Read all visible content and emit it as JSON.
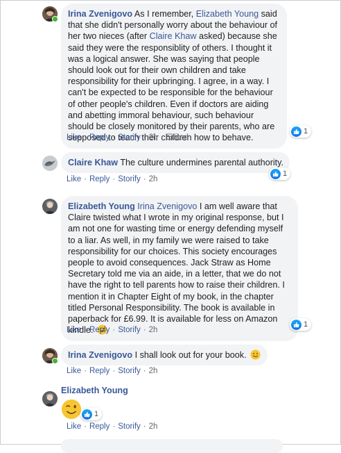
{
  "comments": [
    {
      "author": "Irina Zvenigovo",
      "text_before": " As I remember, ",
      "mention1": "Elizabeth Young",
      "text_mid": " said that she didn't personally worry about the behaviour of her two nieces (after ",
      "mention2": "Claire Khaw",
      "text_after": " asked) because she said they were the responsiblity of others. I thought it was a logical answer. She was saying that people should look out for their own children and take responsibility for their upbringing. I agree, in a way. I can't be expected to be responsible for the behaviour of other people's children. Even if doctors are aiding and abetting immoral behaviour, such behaviour should be closely monitored by their parents, who are supposed to teach their children how to behave.",
      "actions": {
        "like": "Like",
        "reply": "Reply",
        "storify": "Storify",
        "time": "2h",
        "edited": "Edited"
      },
      "reaction_count": "1"
    },
    {
      "author": "Claire Khaw",
      "text": " The culture undermines parental authority.",
      "actions": {
        "like": "Like",
        "reply": "Reply",
        "storify": "Storify",
        "time": "2h"
      },
      "reaction_count": "1"
    },
    {
      "author": "Elizabeth Young",
      "mention": " Irina Zvenigovo",
      "text": " I am well aware that Claire twisted what I wrote in my original response, but I am not one for wasting time or energy defending myself to a liar. As well, in my family we were raised to take responsibility for our choices. This society encourages people to avoid consequences. Jack Straw as Home Secretary told me via an aide, in a letter, that we do not have the right to tell parents how to raise their children. I mention it in Chapter Eight of my book, in the chapter titled Personal Responsibility. The book is available in paperback for £6.99. It is available for less on Amazon kindle.",
      "emoji": "smile-emoji",
      "actions": {
        "like": "Like",
        "reply": "Reply",
        "storify": "Storify",
        "time": "2h"
      },
      "reaction_count": "1"
    },
    {
      "author": "Irina Zvenigovo",
      "text": " I shall look out for your book.",
      "emoji": "slight-smile-emoji",
      "actions": {
        "like": "Like",
        "reply": "Reply",
        "storify": "Storify",
        "time": "2h"
      }
    },
    {
      "author": "Elizabeth Young",
      "sticker": "wink-emoji",
      "actions": {
        "like": "Like",
        "reply": "Reply",
        "storify": "Storify",
        "time": "2h"
      },
      "reaction_count": "1"
    }
  ],
  "colors": {
    "author_link": "#385898",
    "bubble_bg": "#f2f3f5",
    "meta_text": "#616770",
    "like_blue": "#1877f2",
    "online_green": "#42b72a"
  }
}
